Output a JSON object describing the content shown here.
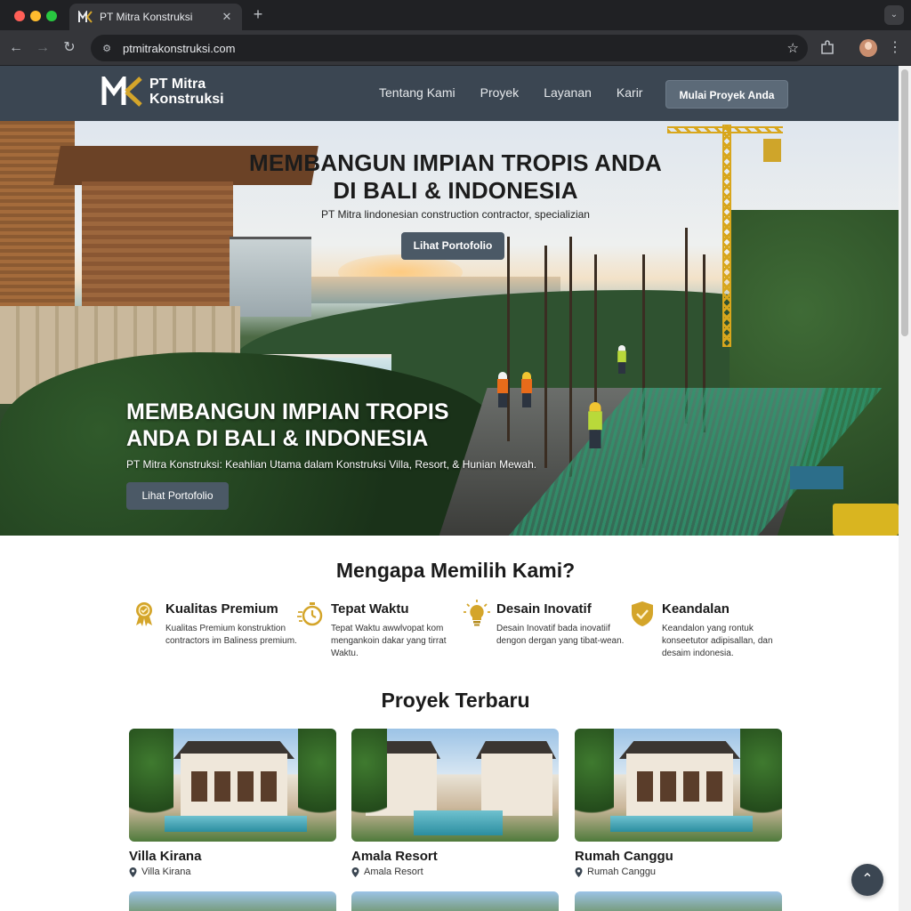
{
  "browser": {
    "tab_title": "PT Mitra Konstruksi",
    "url": "ptmitrakonstruksi.com",
    "new_tab": "+",
    "close_tab": "✕"
  },
  "header": {
    "logo_line1": "PT Mitra",
    "logo_line2": "Konstruksi",
    "nav": [
      "Tentang Kami",
      "Proyek",
      "Layanan",
      "Karir"
    ],
    "cta": "Mulai Proyek Anda"
  },
  "hero": {
    "title_top_line1": "MEMBANGUN IMPIAN TROPIS ANDA",
    "title_top_line2": "DI BALI & INDONESIA",
    "subtitle_top": "PT Mitra lindonesian construction contractor, specializian",
    "button_top": "Lihat Portofolio",
    "title_bottom_line1": "MEMBANGUN IMPIAN TROPIS",
    "title_bottom_line2": "ANDA DI BALI & INDONESIA",
    "subtitle_bottom": "PT Mitra Konstruksi: Keahlian Utama dalam Konstruksi Villa, Resort, & Hunian Mewah.",
    "button_bottom": "Lihat Portofolio"
  },
  "why": {
    "title": "Mengapa Memilih Kami?",
    "features": [
      {
        "title": "Kualitas Premium",
        "desc": "Kualitas Premium konstruktion contractors im Baliness premium.",
        "icon": "award-badge-icon"
      },
      {
        "title": "Tepat Waktu",
        "desc": "Tepat Waktu awwlvopat kom mengankoin dakar yang tirrat Waktu.",
        "icon": "stopwatch-icon"
      },
      {
        "title": "Desain Inovatif",
        "desc": "Desain Inovatif bada inovatiif dengon dergan yang tibat-wean.",
        "icon": "lightbulb-icon"
      },
      {
        "title": "Keandalan",
        "desc": "Keandalon yang rontuk konseetutor adipisallan, dan desaim indonesia.",
        "icon": "shield-check-icon"
      }
    ]
  },
  "projects": {
    "title": "Proyek Terbaru",
    "items": [
      {
        "name": "Villa Kirana",
        "location": "Villa Kirana"
      },
      {
        "name": "Amala Resort",
        "location": "Amala Resort"
      },
      {
        "name": "Rumah Canggu",
        "location": "Rumah Canggu"
      }
    ]
  },
  "colors": {
    "header_bg": "#3b4652",
    "button_bg": "#4b5966",
    "accent_gold": "#d4a52a"
  }
}
